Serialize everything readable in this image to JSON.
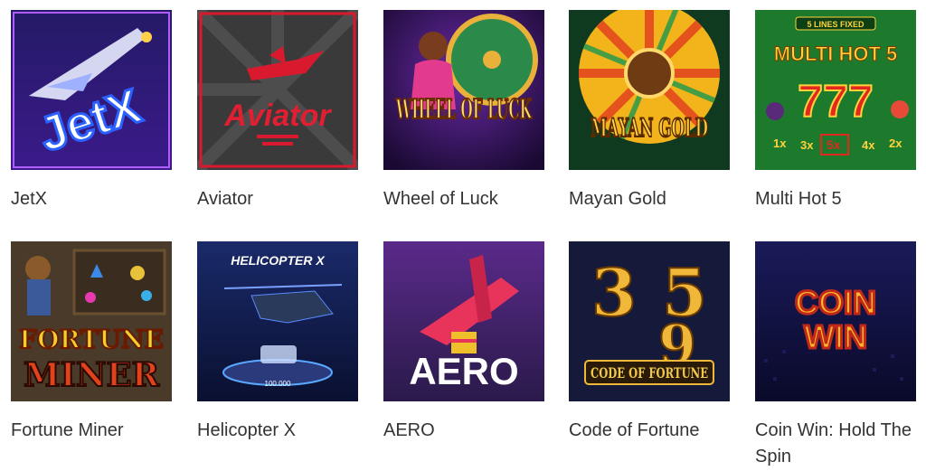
{
  "games": [
    {
      "title": "JetX",
      "art_text": "JetX",
      "icon": "jetx-game-art"
    },
    {
      "title": "Aviator",
      "art_text": "Aviator",
      "icon": "aviator-game-art"
    },
    {
      "title": "Wheel of Luck",
      "art_text": "WHEEL OF LUCK",
      "icon": "wheel-of-luck-game-art"
    },
    {
      "title": "Mayan Gold",
      "art_text": "MAYAN GOLD",
      "icon": "mayan-gold-game-art"
    },
    {
      "title": "Multi Hot 5",
      "art_text": "MULTI HOT 5",
      "badge": "5 LINES FIXED",
      "multipliers": [
        "1x",
        "3x",
        "5x",
        "4x",
        "2x"
      ],
      "icon": "multi-hot-5-game-art"
    },
    {
      "title": "Fortune Miner",
      "art_text": "FORTUNE MINER",
      "icon": "fortune-miner-game-art"
    },
    {
      "title": "Helicopter X",
      "art_text": "HELICOPTER X",
      "counter": "100.000",
      "icon": "helicopter-x-game-art"
    },
    {
      "title": "AERO",
      "art_text": "AERO",
      "icon": "aero-game-art"
    },
    {
      "title": "Code of Fortune",
      "art_text": "CODE OF FORTUNE",
      "icon": "code-of-fortune-game-art"
    },
    {
      "title": "Coin Win: Hold The Spin",
      "art_text": "COIN WIN",
      "icon": "coin-win-game-art"
    }
  ]
}
